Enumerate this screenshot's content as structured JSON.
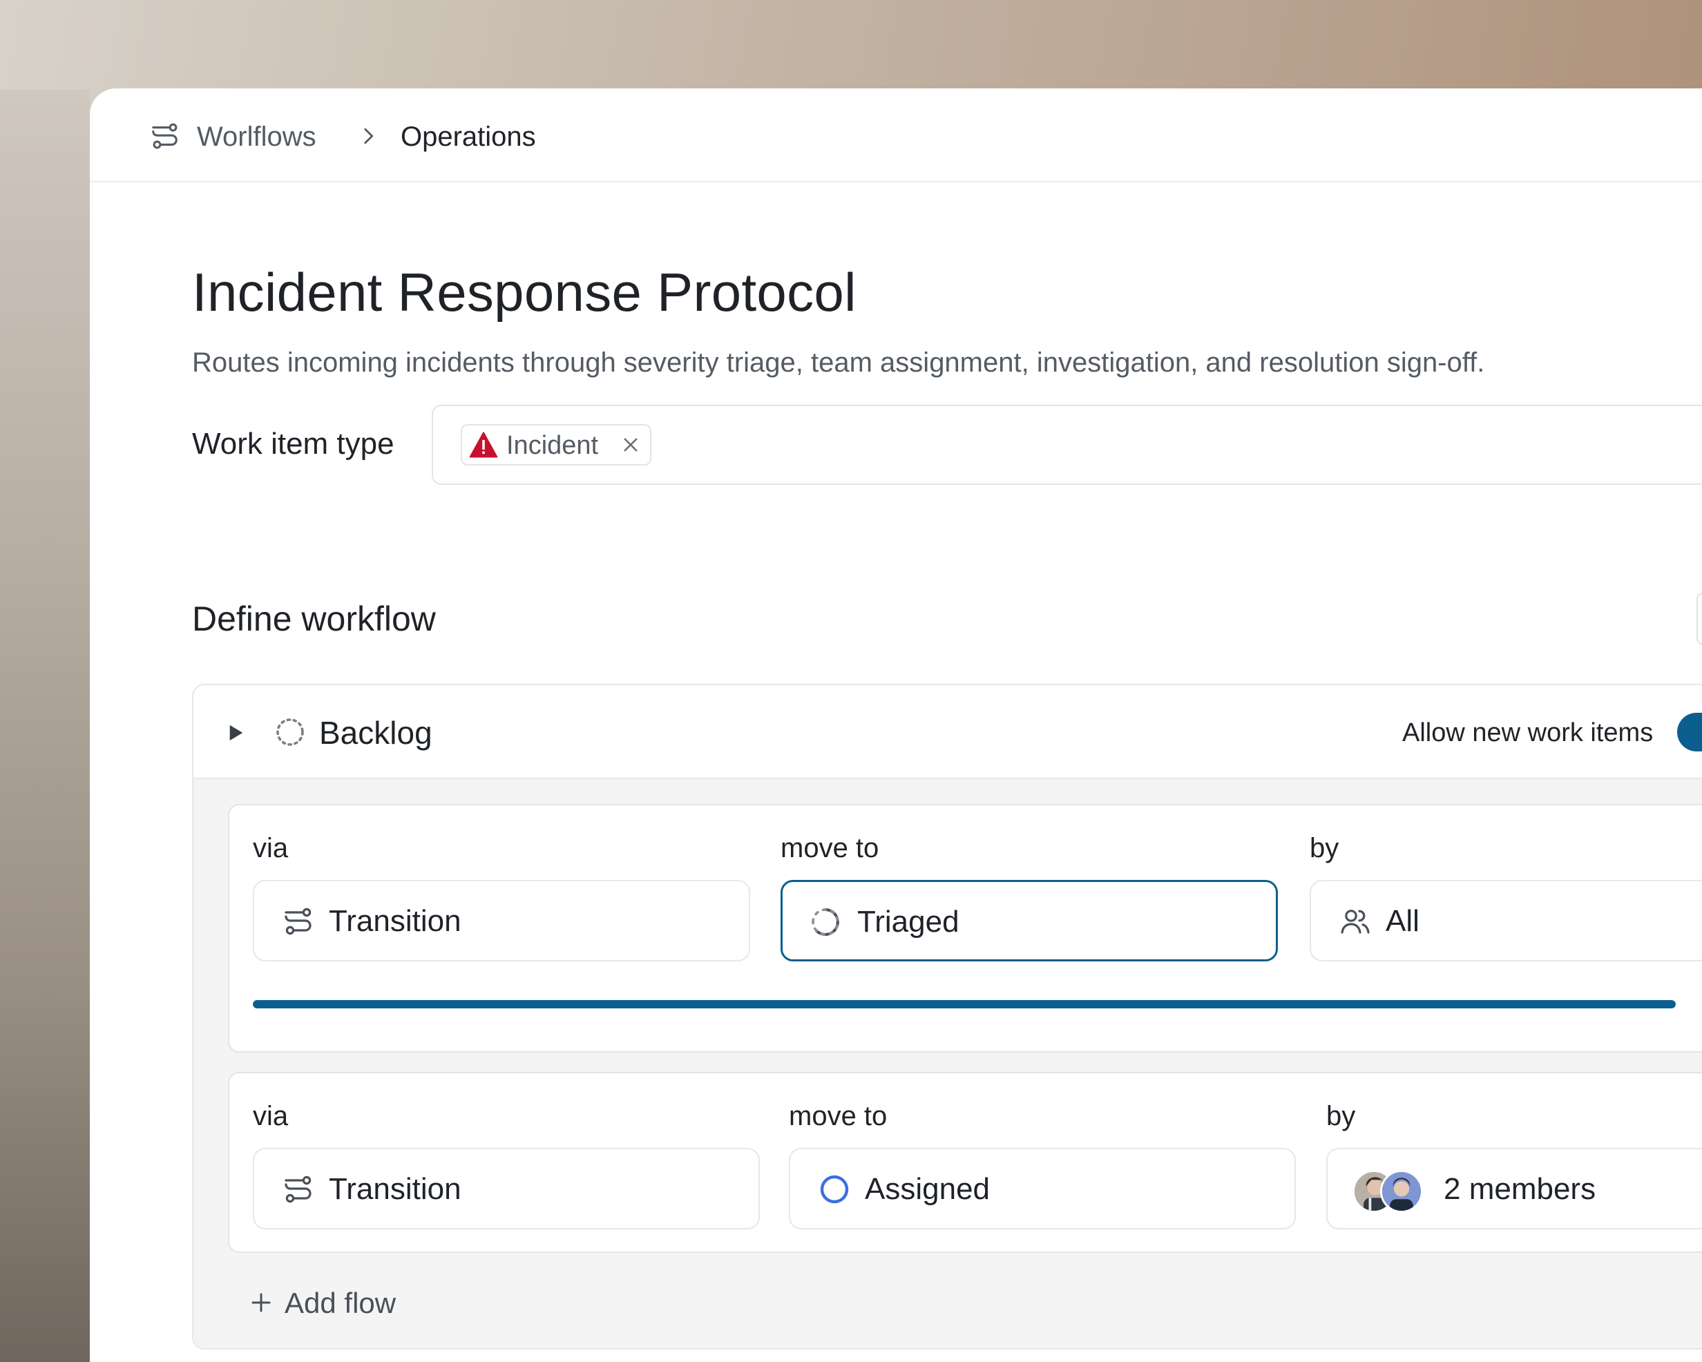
{
  "breadcrumb": {
    "root": "Worlflows",
    "current": "Operations"
  },
  "page": {
    "title": "Incident Response Protocol",
    "description": "Routes incoming incidents through severity triage, team assignment, investigation, and resolution sign-off."
  },
  "work_item_type": {
    "label": "Work item type",
    "chips": [
      {
        "label": "Incident",
        "icon": "warning-triangle-icon",
        "icon_color": "#c8102e"
      }
    ]
  },
  "workflow": {
    "section_title": "Define workflow",
    "status": {
      "name": "Backlog",
      "icon": "backlog-dashed-circle-icon",
      "allow_new_label": "Allow new work items",
      "allow_new_enabled": true
    },
    "flows": [
      {
        "via_label": "via",
        "via_value": "Transition",
        "move_to_label": "move to",
        "move_to_value": "Triaged",
        "move_to_icon": "triaged-progress-icon",
        "by_label": "by",
        "by_value": "All",
        "by_icon": "users-icon",
        "selected_field": "move_to",
        "progress_percent": 100
      },
      {
        "via_label": "via",
        "via_value": "Transition",
        "move_to_label": "move to",
        "move_to_value": "Assigned",
        "move_to_icon": "assigned-circle-icon",
        "by_label": "by",
        "by_value": "2 members",
        "by_icon": "avatar-stack"
      }
    ],
    "add_flow_label": "Add flow"
  },
  "colors": {
    "accent": "#0b5f8e",
    "assigned_blue": "#3b6fe0",
    "panel_bg": "#f4f4f5"
  }
}
